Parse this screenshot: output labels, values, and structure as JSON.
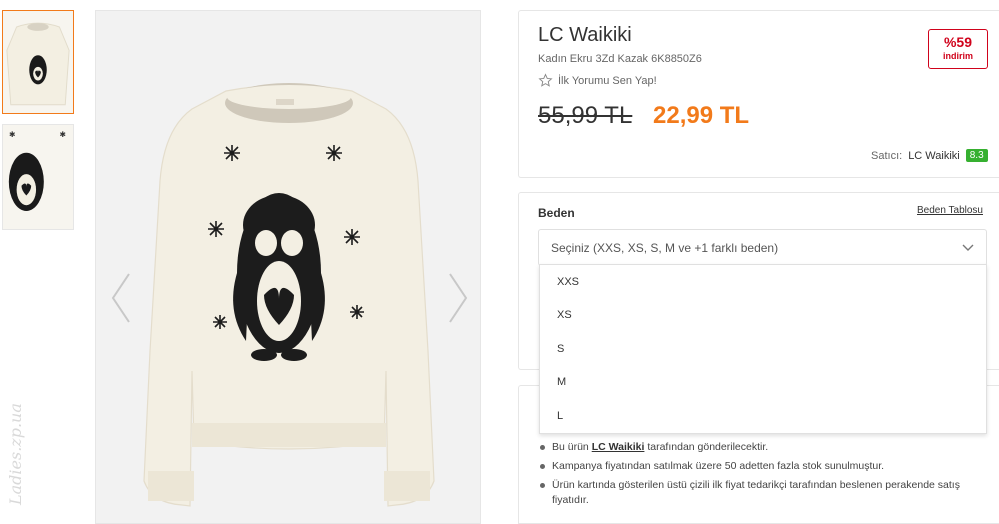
{
  "gallery": {
    "thumbnails": [
      "thumbnail-front",
      "thumbnail-closeup"
    ],
    "prev_icon": "chevron-left-icon",
    "next_icon": "chevron-right-icon"
  },
  "product": {
    "brand": "LC Waikiki",
    "name": "Kadın Ekru 3Zd Kazak 6K8850Z6",
    "review_link": "İlk Yorumu Sen Yap!",
    "old_price": "55,99 TL",
    "new_price": "22,99 TL",
    "discount_percent": "%59",
    "discount_label": "indirim",
    "seller_label": "Satıcı:",
    "seller_name": "LC Waikiki",
    "seller_score": "8.3"
  },
  "size": {
    "title": "Beden",
    "chart_link": "Beden Tablosu",
    "placeholder": "Seçiniz (XXS, XS, S, M ve +1 farklı beden)",
    "options": [
      "XXS",
      "XS",
      "S",
      "M",
      "L"
    ]
  },
  "info": {
    "line1_prefix": "Bu ürün ",
    "line1_brand": "LC Waikiki",
    "line1_suffix": " tarafından gönderilecektir.",
    "line2": "Kampanya fiyatından satılmak üzere 50 adetten fazla stok sunulmuştur.",
    "line3": "Ürün kartında gösterilen üstü çizili ilk fiyat tedarikçi tarafından beslenen perakende satış fiyatıdır."
  },
  "watermark": "Ladies.zp.ua",
  "colors": {
    "accent_orange": "#f27a1a",
    "discount_red": "#d0021b",
    "score_green": "#36b030"
  }
}
